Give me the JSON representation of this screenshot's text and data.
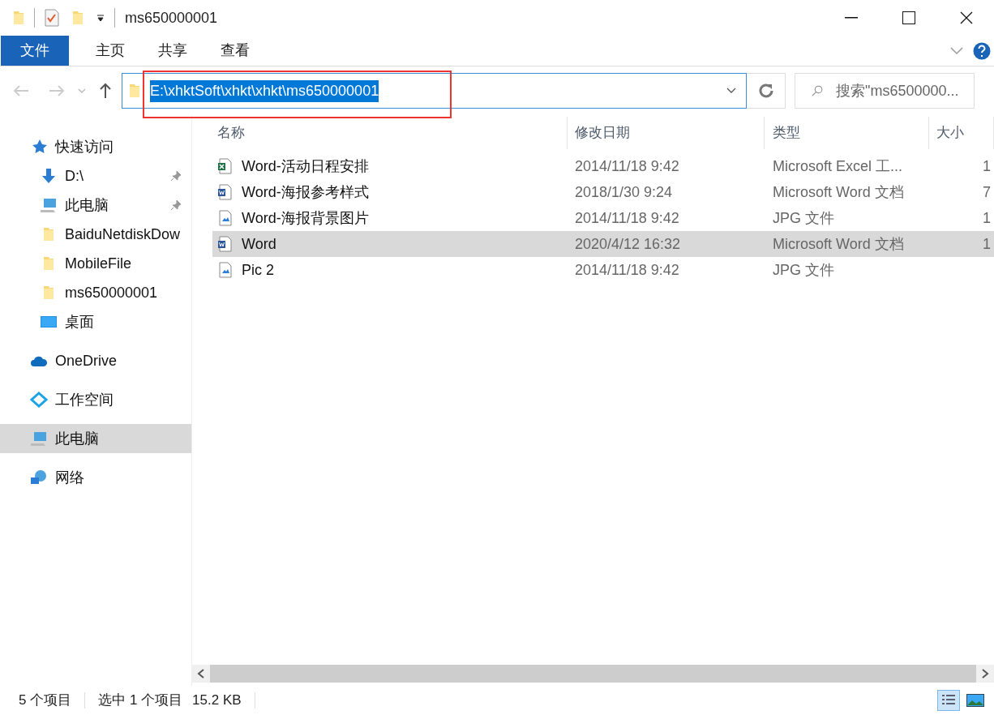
{
  "window": {
    "title": "ms650000001"
  },
  "ribbon_tabs": [
    {
      "label": "文件",
      "selected": true
    },
    {
      "label": "主页",
      "selected": false
    },
    {
      "label": "共享",
      "selected": false
    },
    {
      "label": "查看",
      "selected": false
    }
  ],
  "address": {
    "value": "E:\\xhktSoft\\xhkt\\xhkt\\ms650000001",
    "highlighted": true
  },
  "search": {
    "placeholder": "搜索\"ms6500000..."
  },
  "sidebar": {
    "items": [
      {
        "label": "快速访问",
        "kind": "star",
        "selected": false,
        "children": [
          {
            "label": "D:\\",
            "kind": "download",
            "pinned": true,
            "selected": false
          },
          {
            "label": "此电脑",
            "kind": "pc",
            "pinned": true,
            "selected": false
          },
          {
            "label": "BaiduNetdiskDow",
            "kind": "folder",
            "pinned": false,
            "selected": false
          },
          {
            "label": "MobileFile",
            "kind": "folder",
            "pinned": false,
            "selected": false
          },
          {
            "label": "ms650000001",
            "kind": "folder",
            "pinned": false,
            "selected": false
          },
          {
            "label": "桌面",
            "kind": "desktop",
            "pinned": false,
            "selected": false
          }
        ]
      },
      {
        "label": "OneDrive",
        "kind": "cloud",
        "selected": false
      },
      {
        "label": "工作空间",
        "kind": "workspace",
        "selected": false
      },
      {
        "label": "此电脑",
        "kind": "pc",
        "selected": true
      },
      {
        "label": "网络",
        "kind": "network",
        "selected": false
      }
    ]
  },
  "table": {
    "columns": [
      "名称",
      "修改日期",
      "类型",
      "大小"
    ],
    "rows": [
      {
        "kind": "excel",
        "name": "Word-活动日程安排",
        "date": "2014/11/18 9:42",
        "type": "Microsoft Excel 工...",
        "size": "1",
        "selected": false
      },
      {
        "kind": "word",
        "name": "Word-海报参考样式",
        "date": "2018/1/30 9:24",
        "type": "Microsoft Word 文档",
        "size": "7",
        "selected": false
      },
      {
        "kind": "image",
        "name": "Word-海报背景图片",
        "date": "2014/11/18 9:42",
        "type": "JPG 文件",
        "size": "1",
        "selected": false
      },
      {
        "kind": "word",
        "name": "Word",
        "date": "2020/4/12 16:32",
        "type": "Microsoft Word 文档",
        "size": "1",
        "selected": true
      },
      {
        "kind": "image",
        "name": "Pic 2",
        "date": "2014/11/18 9:42",
        "type": "JPG 文件",
        "selected": false
      }
    ]
  },
  "status_bar": {
    "count": "5 个项目",
    "selection": "选中 1 个项目",
    "size": "15.2 KB"
  }
}
